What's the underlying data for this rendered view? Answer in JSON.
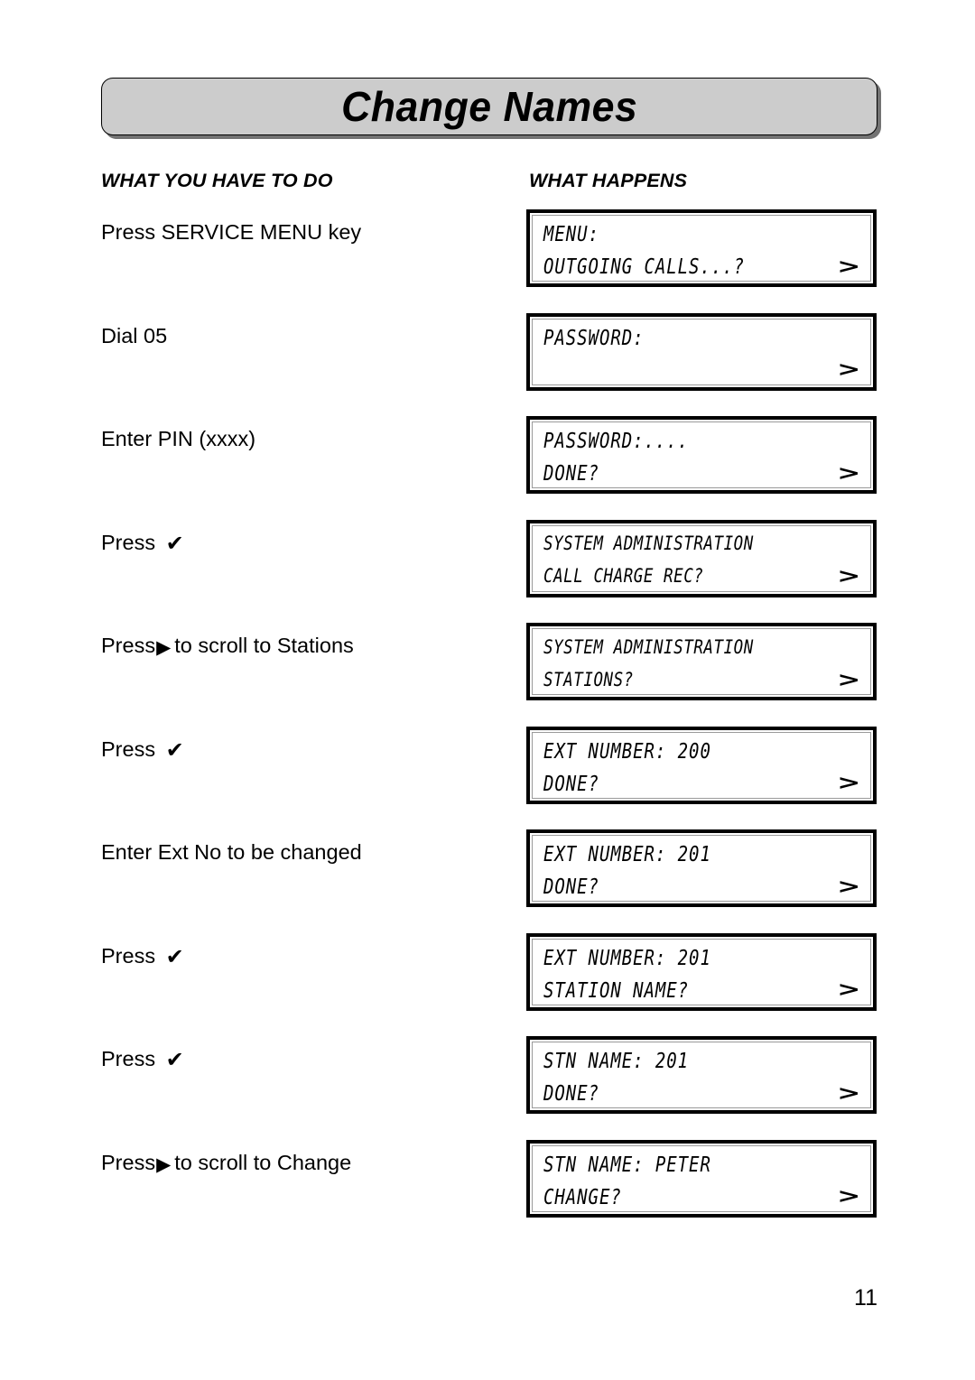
{
  "document": {
    "title": "Change Names",
    "page_number": "11"
  },
  "columns": {
    "left_heading": "WHAT YOU HAVE TO DO",
    "right_heading": "WHAT HAPPENS"
  },
  "glyphs": {
    "tick": "✔",
    "arrow_right": "▶",
    "chevron": ">"
  },
  "steps": [
    {
      "instruction_before": "Press SERVICE MENU key",
      "glyph": "",
      "instruction_after": "",
      "display": {
        "line1": "MENU:",
        "line2": "OUTGOING CALLS...?",
        "chevron": ">",
        "wide": false
      }
    },
    {
      "instruction_before": "Dial 05",
      "glyph": "",
      "instruction_after": "",
      "display": {
        "line1": "PASSWORD:",
        "line2": "",
        "chevron": ">",
        "wide": false
      }
    },
    {
      "instruction_before": "Enter PIN (xxxx)",
      "glyph": "",
      "instruction_after": "",
      "display": {
        "line1": "PASSWORD:....",
        "line2": "DONE?",
        "chevron": ">",
        "wide": false
      }
    },
    {
      "instruction_before": "Press ",
      "glyph": "✔",
      "instruction_after": "",
      "display": {
        "line1": "SYSTEM ADMINISTRATION",
        "line2": "CALL CHARGE REC?",
        "chevron": ">",
        "wide": true
      }
    },
    {
      "instruction_before": "Press",
      "glyph": "▶",
      "instruction_after": "to scroll to Stations",
      "display": {
        "line1": "SYSTEM ADMINISTRATION",
        "line2": "STATIONS?",
        "chevron": ">",
        "wide": true
      }
    },
    {
      "instruction_before": "Press ",
      "glyph": "✔",
      "instruction_after": "",
      "display": {
        "line1": "EXT NUMBER: 200",
        "line2": "DONE?",
        "chevron": ">",
        "wide": false
      }
    },
    {
      "instruction_before": "Enter Ext No to be changed",
      "glyph": "",
      "instruction_after": "",
      "display": {
        "line1": "EXT NUMBER: 201",
        "line2": "DONE?",
        "chevron": ">",
        "wide": false
      }
    },
    {
      "instruction_before": "Press ",
      "glyph": "✔",
      "instruction_after": "",
      "display": {
        "line1": "EXT NUMBER: 201",
        "line2": "STATION NAME?",
        "chevron": ">",
        "wide": false
      }
    },
    {
      "instruction_before": "Press ",
      "glyph": "✔",
      "instruction_after": "",
      "display": {
        "line1": "STN NAME: 201",
        "line2": "DONE?",
        "chevron": ">",
        "wide": false
      }
    },
    {
      "instruction_before": "Press",
      "glyph": "▶",
      "instruction_after": "to scroll to Change",
      "display": {
        "line1": "STN NAME: PETER",
        "line2": "CHANGE?",
        "chevron": ">",
        "wide": false
      }
    }
  ]
}
